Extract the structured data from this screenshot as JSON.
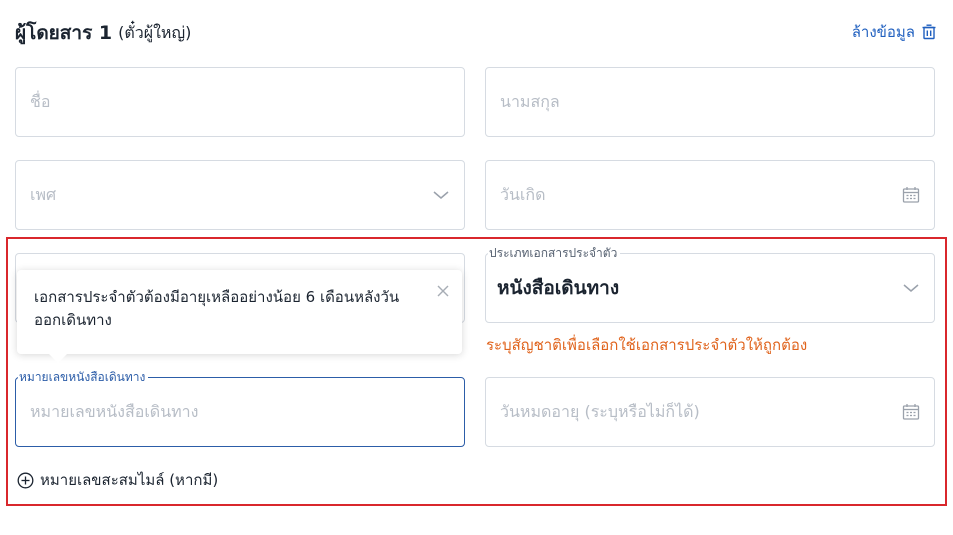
{
  "section": {
    "title": "ผู้โดยสาร 1",
    "subtitle": "(ตั๋วผู้ใหญ่)",
    "clear_label": "ล้างข้อมูล"
  },
  "fields": {
    "first_name": {
      "placeholder": "ชื่อ"
    },
    "last_name": {
      "placeholder": "นามสกุล"
    },
    "gender": {
      "placeholder": "เพศ"
    },
    "birth_date": {
      "placeholder": "วันเกิด"
    },
    "doc_type": {
      "label": "ประเภทเอกสารประจำตัว",
      "value": "หนังสือเดินทาง"
    },
    "passport_no": {
      "label": "หมายเลขหนังสือเดินทาง",
      "placeholder": "หมายเลขหนังสือเดินทาง"
    },
    "expiry": {
      "placeholder": "วันหมดอายุ (ระบุหรือไม่ก็ได้)"
    }
  },
  "messages": {
    "tooltip": "เอกสารประจำตัวต้องมีอายุเหลืออย่างน้อย 6 เดือนหลังวันออกเดินทาง",
    "nationality_hint": "ระบุสัญชาติเพื่อเลือกใช้เอกสารประจำตัวให้ถูกต้อง"
  },
  "add_miles_label": "หมายเลขสะสมไมล์ (หากมี)",
  "colors": {
    "accent": "#2c5da8",
    "error": "#e0631c",
    "highlight_box": "#d9272c"
  },
  "icons": {
    "clear": "trash-icon",
    "dropdown": "chevron-down-icon",
    "date": "calendar-icon",
    "close": "close-icon",
    "add": "plus-circle-icon"
  }
}
